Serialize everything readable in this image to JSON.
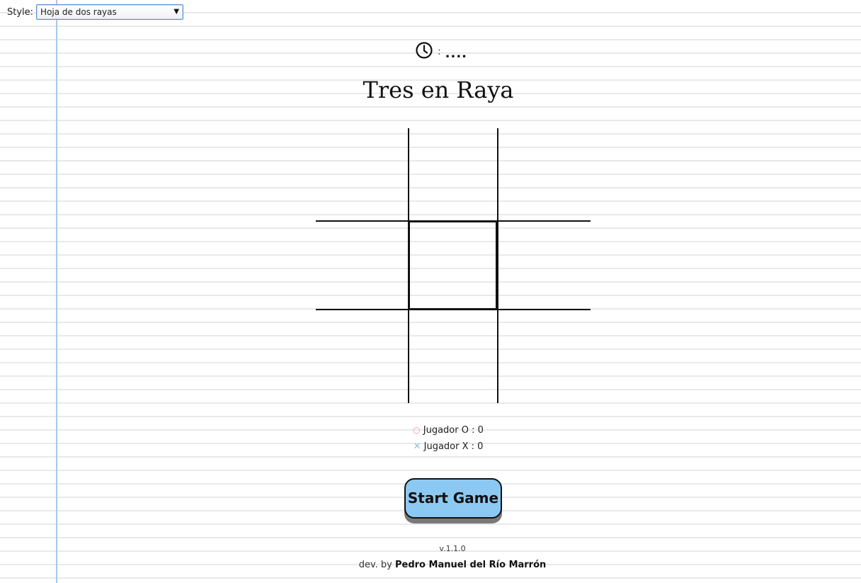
{
  "style_selector": {
    "label": "Style:",
    "selected": "Hoja de dos rayas"
  },
  "timer": {
    "icon": "clock-icon",
    "separator": ":",
    "value": "...."
  },
  "title": "Tres en Raya",
  "board": {
    "cells": [
      "",
      "",
      "",
      "",
      "",
      "",
      "",
      "",
      ""
    ]
  },
  "scores": {
    "player_o": {
      "mark": "○",
      "label": "Jugador O : 0"
    },
    "player_x": {
      "mark": "✕",
      "label": "Jugador X : 0"
    }
  },
  "start_button": "Start Game",
  "footer": {
    "version": "v.1.1.0",
    "credit_prefix": "dev. by",
    "author": "Pedro Manuel del Río Marrón"
  },
  "colors": {
    "button": "#8cc9f2",
    "margin_line": "#a9c8e8",
    "ruled_line": "#e9e9e9",
    "mark_o": "#e49aa4",
    "mark_x": "#8fbfe0"
  }
}
